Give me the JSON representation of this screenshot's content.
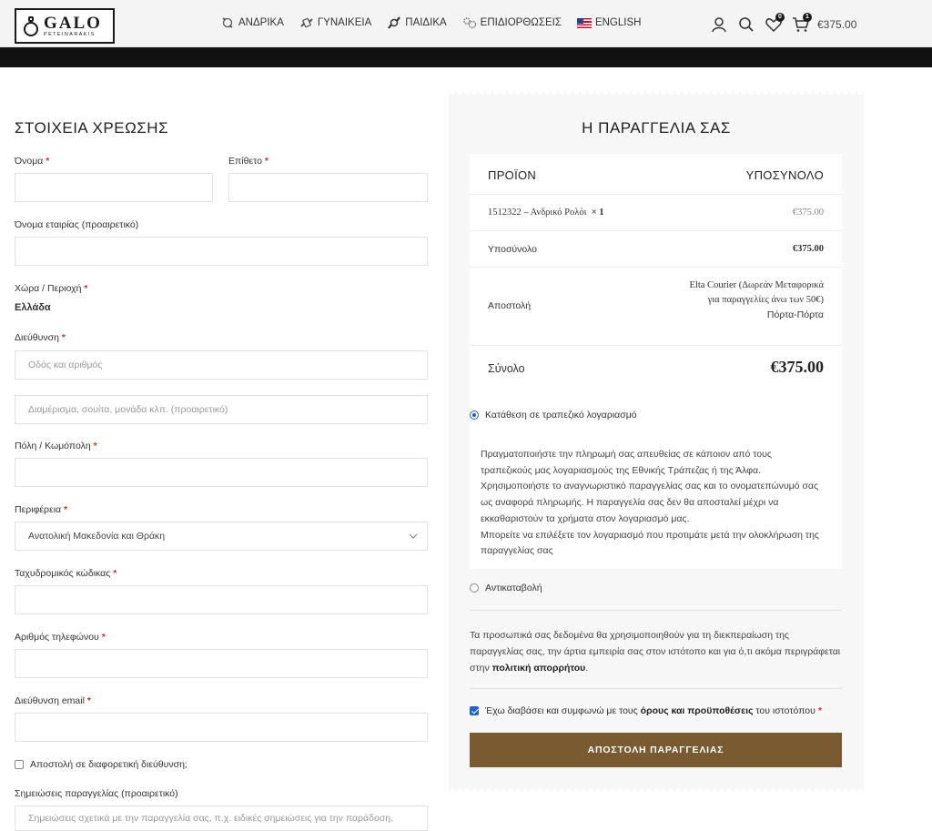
{
  "header": {
    "logo_main": "GALO",
    "logo_sub": "PETEINARAKIS",
    "nav": [
      {
        "label": "ΑΝΔΡΙΚΑ",
        "icon": "watch-icon"
      },
      {
        "label": "ΓΥΝΑΙΚΕΙΑ",
        "icon": "bracelet-icon"
      },
      {
        "label": "ΠΑΙΔΙΚΑ",
        "icon": "kids-watch-icon"
      },
      {
        "label": "ΕΠΙΔΙΟΡΘΩΣΕΙΣ",
        "icon": "gears-icon"
      },
      {
        "label": "ENGLISH",
        "icon": "us-flag-icon"
      }
    ],
    "wishlist_count": "0",
    "cart_count": "1",
    "cart_total": "€375.00"
  },
  "billing": {
    "title": "ΣΤΟΙΧΕΙΑ ΧΡΕΩΣΗΣ",
    "first_name_label": "Όνομα",
    "last_name_label": "Επίθετο",
    "company_label": "Όνομα εταιρίας (προαιρετικό)",
    "country_label": "Χώρα / Περιοχή",
    "country_value": "Ελλάδα",
    "address_label": "Διεύθυνση",
    "address_placeholder": "Οδός και αριθμός",
    "address2_placeholder": "Διαμέρισμα, σουίτα, μονάδα κλπ. (προαιρετικό)",
    "city_label": "Πόλη / Κωμόπολη",
    "region_label": "Περιφέρεια",
    "region_value": "Ανατολική Μακεδονία και Θράκη",
    "postcode_label": "Ταχυδρομικός κώδικας",
    "phone_label": "Αριθμός τηλεφώνου",
    "email_label": "Διεύθυνση email",
    "ship_different_label": "Αποστολή σε διαφορετική διεύθυνση;",
    "notes_label": "Σημειώσεις παραγγελίας (προαιρετικό)",
    "notes_placeholder": "Σημειώσεις σχετικά με την παραγγελία σας, π.χ. ειδικές σημειώσεις για την παράδοση.",
    "required_mark": "*"
  },
  "order": {
    "title": "Η ΠΑΡΑΓΓΕΛΙΑ ΣΑΣ",
    "col_product": "ΠΡΟΪΟΝ",
    "col_subtotal": "ΥΠΟΣΥΝΟΛΟ",
    "item_name": "1512322 – Ανδρικό Ρολόι",
    "item_qty": "× 1",
    "item_price": "€375.00",
    "subtotal_label": "Υποσύνολο",
    "subtotal_value": "€375.00",
    "shipping_label": "Αποστολή",
    "shipping_line1": "Elta Courier (Δωρεάν Μεταφορικά",
    "shipping_line2": "για παραγγελίες άνω των 50€)",
    "shipping_line3": "Πόρτα-Πόρτα",
    "total_label": "Σύνολο",
    "total_value": "€375.00"
  },
  "payment": {
    "bank_label": "Κατάθεση σε τραπεζικό λογαριασμό",
    "bank_desc_lines": [
      "Πραγματοποιήστε την πληρωμή σας απευθείας σε κάποιον από τους",
      "τραπεζικούς μας λογαριασμούς της Εθνικής Τράπεζας ή της Άλφα.",
      "Χρησιμοποιήστε το αναγνωριστικό παραγγελίας σας και το ονοματεπώνυμό σας",
      "ως αναφορά πληρωμής. Η παραγγελία σας δεν θα αποσταλεί μέχρι να",
      "εκκαθαριστούν τα χρήματα στον λογαριασμό μας.",
      "Μπορείτε να επιλέξετε τον λογαριασμό που προτιμάτε μετά την ολοκλήρωση της",
      "παραγγελίας σας"
    ],
    "cod_label": "Αντικαταβολή",
    "privacy_text_1": "Τα προσωπικά σας δεδομένα θα χρησιμοποιηθούν για τη διεκπεραίωση της παραγγελίας σας, την άρτια εμπειρία σας στον ιστότοπο και για ό,τι ακόμα περιγράφεται στην",
    "privacy_link": "πολιτική απορρήτου",
    "privacy_end": ".",
    "terms_pre": "Έχω διαβάσει και συμφωνώ με τους",
    "terms_link": "όρους και προϋποθέσεις",
    "terms_post": "του ιστοτόπου",
    "place_order": "ΑΠΟΣΤΟΛΗ ΠΑΡΑΓΓΕΛΙΑΣ"
  }
}
